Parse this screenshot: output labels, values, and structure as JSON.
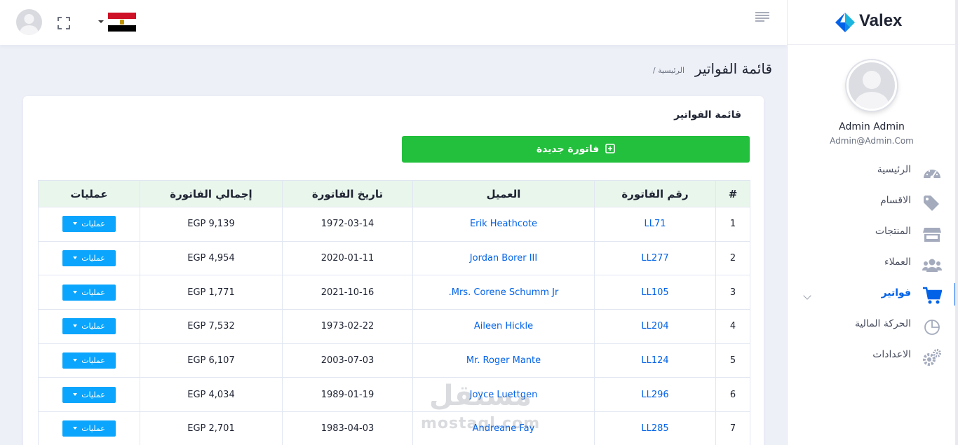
{
  "header": {
    "flag_colors": [
      "#ce1126",
      "#ffffff",
      "#000000"
    ]
  },
  "brand": {
    "name": "Valex",
    "colors": [
      "#0162e8",
      "#1cb5e0"
    ]
  },
  "profile": {
    "name": "Admin Admin",
    "email": "Admin@Admin.Com"
  },
  "sidebar": {
    "items": [
      {
        "label": "الرئيسية",
        "icon": "dashboard-gauge-icon"
      },
      {
        "label": "الاقسام",
        "icon": "tags-icon"
      },
      {
        "label": "المنتجات",
        "icon": "store-icon"
      },
      {
        "label": "العملاء",
        "icon": "users-icon"
      },
      {
        "label": "فواتير",
        "icon": "cart-icon",
        "active": true
      },
      {
        "label": "الحركة المالية",
        "icon": "pie-chart-icon"
      },
      {
        "label": "الاعدادات",
        "icon": "cogs-icon"
      }
    ]
  },
  "page": {
    "title": "قائمة الفواتير",
    "breadcrumb": "/ الرئيسية"
  },
  "card": {
    "title": "قائمة الفواتير",
    "new_button": "فاتورة جديدة"
  },
  "table": {
    "headers": [
      "#",
      "رقم الفاتورة",
      "العميل",
      "تاريخ الفاتورة",
      "إجمالي الفاتورة",
      "عمليات"
    ],
    "ops_label": "عمليات",
    "rows": [
      {
        "idx": "1",
        "invoice": "LL71",
        "client": "Erik Heathcote",
        "date": "1972-03-14",
        "total": "EGP 9,139"
      },
      {
        "idx": "2",
        "invoice": "LL277",
        "client": "Jordan Borer III",
        "date": "2020-01-11",
        "total": "EGP 4,954"
      },
      {
        "idx": "3",
        "invoice": "LL105",
        "client": "Mrs. Corene Schumm Jr.",
        "date": "2021-10-16",
        "total": "EGP 1,771"
      },
      {
        "idx": "4",
        "invoice": "LL204",
        "client": "Aileen Hickle",
        "date": "1973-02-22",
        "total": "EGP 7,532"
      },
      {
        "idx": "5",
        "invoice": "LL124",
        "client": "Mr. Roger Mante",
        "date": "2003-07-03",
        "total": "EGP 6,107"
      },
      {
        "idx": "6",
        "invoice": "LL296",
        "client": "Joyce Luettgen",
        "date": "1989-01-19",
        "total": "EGP 4,034"
      },
      {
        "idx": "7",
        "invoice": "LL285",
        "client": "Andreane Fay",
        "date": "1983-04-03",
        "total": "EGP 2,701"
      }
    ]
  },
  "watermark": {
    "arabic": "مستقل",
    "latin": "mostaql.com"
  }
}
